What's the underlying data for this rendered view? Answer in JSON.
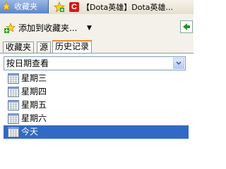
{
  "tabs": {
    "active_label": "收藏夹",
    "page_tab_title": "【Dota英雄】Dota英雄..."
  },
  "toolbar": {
    "add_to_favorites_label": "添加到收藏夹...",
    "dropdown_glyph": "▼"
  },
  "subtabs": [
    "收藏夹",
    "源",
    "历史记录"
  ],
  "history": {
    "view_by": "按日期查看",
    "items": [
      "星期三",
      "星期四",
      "星期五",
      "星期六",
      "今天"
    ],
    "selected_index": 4
  },
  "colors": {
    "selection": "#316ac5",
    "active_tab_accent": "#e68b2c"
  }
}
